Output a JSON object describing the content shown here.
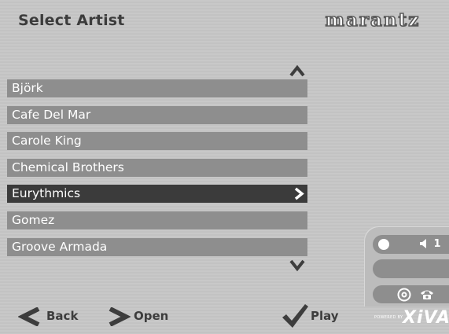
{
  "header": {
    "title": "Select Artist",
    "brand": "marantz"
  },
  "artists": [
    {
      "label": "Björk",
      "selected": false
    },
    {
      "label": "Cafe Del Mar",
      "selected": false
    },
    {
      "label": "Carole King",
      "selected": false
    },
    {
      "label": "Chemical Brothers",
      "selected": false
    },
    {
      "label": "Eurythmics",
      "selected": true
    },
    {
      "label": "Gomez",
      "selected": false
    },
    {
      "label": "Groove Armada",
      "selected": false
    }
  ],
  "status": {
    "volume": "1"
  },
  "footer": {
    "back_label": "Back",
    "open_label": "Open",
    "play_label": "Play",
    "powered_by": "POWERED BY",
    "platform": "XiVA"
  },
  "colors": {
    "row_normal": "#8e8e8e",
    "row_selected": "#3b3b3b",
    "text_dark": "#3d3d3d"
  },
  "icons": {
    "scroll_up": "scroll-up-icon",
    "scroll_down": "scroll-down-icon",
    "back": "back-arrow-icon",
    "open": "open-arrow-icon",
    "play": "checkmark-icon",
    "volume": "speaker-icon",
    "cd": "cd-icon",
    "phone": "phone-icon"
  }
}
